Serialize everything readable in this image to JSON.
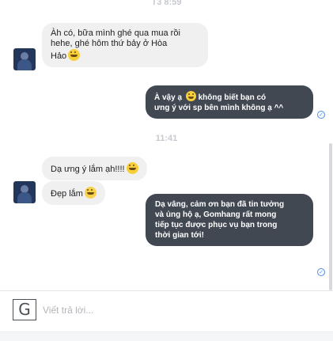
{
  "timestamps": {
    "top": "T3 8:59",
    "middle": "11:41"
  },
  "messages": {
    "incoming_1": {
      "line1": "Àh có, bữa mình ghé qua mua rồi",
      "line2": "hehe, ghé hôm thứ bảy ở Hòa",
      "line3": "Hảo"
    },
    "outgoing_1": {
      "line1_pre": "À vậy ạ",
      "line1_post": "không biết bạn có",
      "line2": "ưng ý với sp bên mình không ạ ^^"
    },
    "incoming_2": {
      "text": "Dạ ưng ý lắm ạh!!!!"
    },
    "incoming_3": {
      "text": "Đẹp lắm"
    },
    "outgoing_2": {
      "line1": "Dạ vâng, cảm ơn bạn đã tin tưởng",
      "line2": "và ủng hộ ạ, Gomhang rất mong",
      "line3": "tiếp tục được phục vụ bạn trong",
      "line4": "thời gian tới!"
    }
  },
  "icons": {
    "emoji": "grinning-emoji",
    "seen": "seen-check-icon",
    "composer": "g-icon",
    "avatar": "avatar"
  },
  "composer": {
    "g_label": "G",
    "placeholder": "Viết trả lời..."
  },
  "colors": {
    "outgoing_bubble": "#414852",
    "incoming_bubble": "#f1f0f0",
    "seen_icon": "#4a8de6",
    "timestamp": "#c6c9cf"
  }
}
